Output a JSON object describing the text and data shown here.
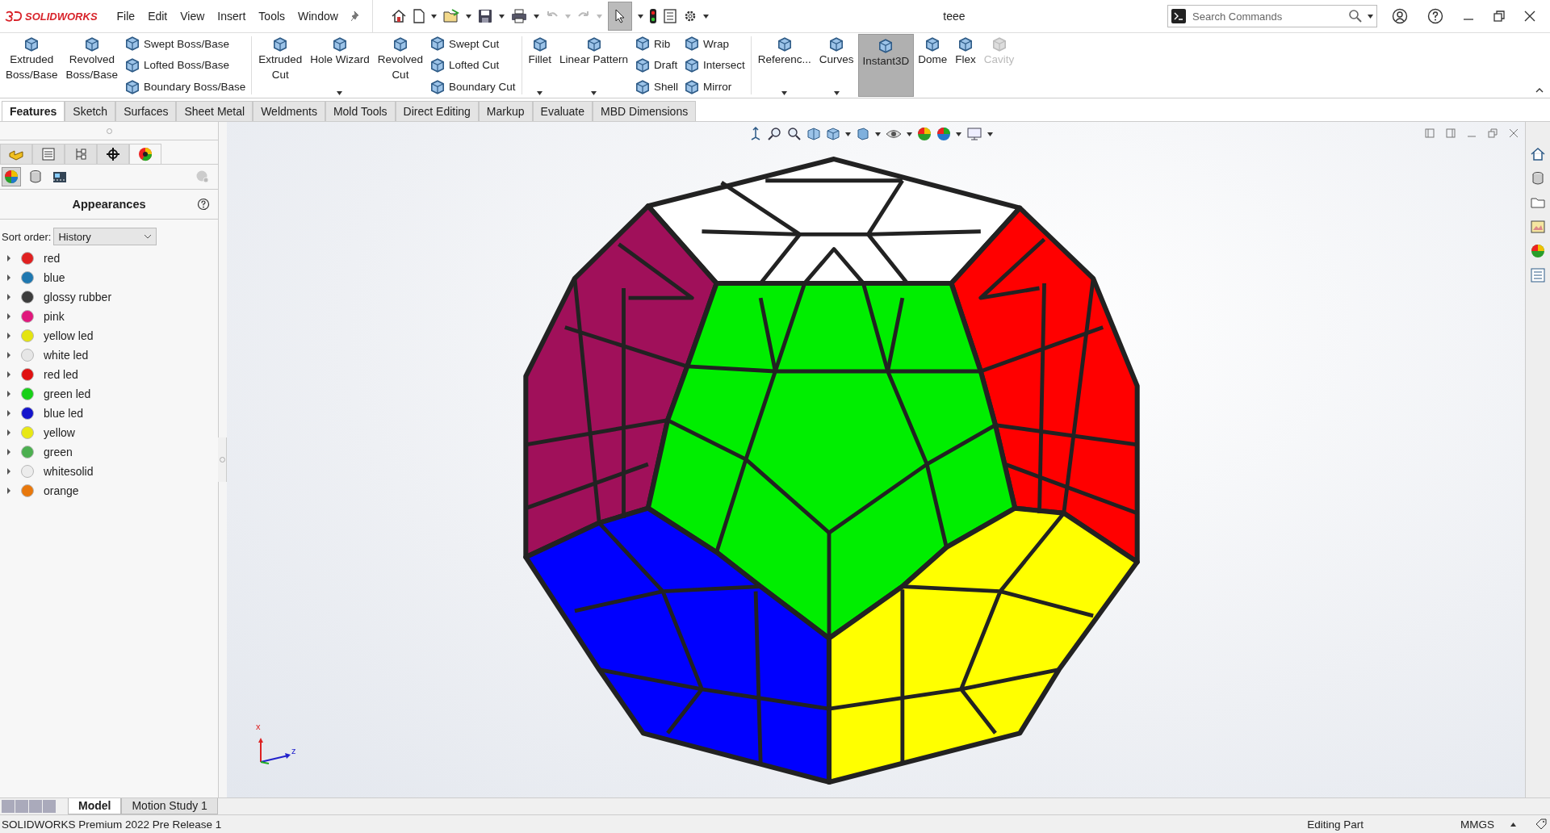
{
  "app": {
    "logo": "SOLIDWORKS"
  },
  "menu": [
    "File",
    "Edit",
    "View",
    "Insert",
    "Tools",
    "Window"
  ],
  "window": {
    "title": "teee"
  },
  "search": {
    "placeholder": "Search Commands"
  },
  "ribbon": [
    {
      "kind": "large",
      "lines": [
        "Extruded",
        "Boss/Base"
      ],
      "dropdown": false,
      "selected": false,
      "disabled": false
    },
    {
      "kind": "large",
      "lines": [
        "Revolved",
        "Boss/Base"
      ],
      "dropdown": false,
      "selected": false,
      "disabled": false
    },
    {
      "kind": "stack",
      "items": [
        "Swept Boss/Base",
        "Lofted Boss/Base",
        "Boundary Boss/Base"
      ]
    },
    {
      "kind": "separator"
    },
    {
      "kind": "large",
      "lines": [
        "Extruded",
        "Cut"
      ],
      "dropdown": false,
      "selected": false,
      "disabled": false
    },
    {
      "kind": "large",
      "lines": [
        "Hole Wizard"
      ],
      "dropdown": true,
      "selected": false,
      "disabled": false
    },
    {
      "kind": "large",
      "lines": [
        "Revolved",
        "Cut"
      ],
      "dropdown": false,
      "selected": false,
      "disabled": false
    },
    {
      "kind": "stack",
      "items": [
        "Swept Cut",
        "Lofted Cut",
        "Boundary Cut"
      ]
    },
    {
      "kind": "separator"
    },
    {
      "kind": "large",
      "lines": [
        "Fillet"
      ],
      "dropdown": true,
      "selected": false,
      "disabled": false
    },
    {
      "kind": "large",
      "lines": [
        "Linear Pattern"
      ],
      "dropdown": true,
      "selected": false,
      "disabled": false
    },
    {
      "kind": "stack",
      "items": [
        "Rib",
        "Draft",
        "Shell"
      ]
    },
    {
      "kind": "stack",
      "items": [
        "Wrap",
        "Intersect",
        "Mirror"
      ]
    },
    {
      "kind": "separator"
    },
    {
      "kind": "large",
      "lines": [
        "Referenc..."
      ],
      "dropdown": true,
      "selected": false,
      "disabled": false
    },
    {
      "kind": "large",
      "lines": [
        "Curves"
      ],
      "dropdown": true,
      "selected": false,
      "disabled": false
    },
    {
      "kind": "large",
      "lines": [
        "Instant3D"
      ],
      "dropdown": false,
      "selected": true,
      "disabled": false
    },
    {
      "kind": "large",
      "lines": [
        "Dome"
      ],
      "dropdown": false,
      "selected": false,
      "disabled": false
    },
    {
      "kind": "large",
      "lines": [
        "Flex"
      ],
      "dropdown": false,
      "selected": false,
      "disabled": false
    },
    {
      "kind": "large",
      "lines": [
        "Cavity"
      ],
      "dropdown": false,
      "selected": false,
      "disabled": true
    }
  ],
  "command_tabs": [
    {
      "label": "Features",
      "selected": true
    },
    {
      "label": "Sketch",
      "selected": false
    },
    {
      "label": "Surfaces",
      "selected": false
    },
    {
      "label": "Sheet Metal",
      "selected": false
    },
    {
      "label": "Weldments",
      "selected": false
    },
    {
      "label": "Mold Tools",
      "selected": false
    },
    {
      "label": "Direct Editing",
      "selected": false
    },
    {
      "label": "Markup",
      "selected": false
    },
    {
      "label": "Evaluate",
      "selected": false
    },
    {
      "label": "MBD Dimensions",
      "selected": false
    }
  ],
  "panel": {
    "tabs": [
      {
        "selected": false
      },
      {
        "selected": false
      },
      {
        "selected": false
      },
      {
        "selected": false
      },
      {
        "selected": true
      }
    ],
    "subtabs": [
      {
        "selected": true
      },
      {
        "selected": false
      },
      {
        "selected": false
      }
    ],
    "title": "Appearances",
    "sort_label": "Sort order:",
    "sort_value": "History",
    "appearances": [
      {
        "name": "red",
        "color": "#e02020",
        "expanded": false
      },
      {
        "name": "blue",
        "color": "#1f78b0",
        "expanded": false
      },
      {
        "name": "glossy rubber",
        "color": "#3c3c3c",
        "expanded": false
      },
      {
        "name": "pink",
        "color": "#e0187c",
        "expanded": false
      },
      {
        "name": "yellow led",
        "color": "#e4e410",
        "expanded": false
      },
      {
        "name": "white led",
        "color": "#e6e6e6",
        "expanded": false
      },
      {
        "name": "red led",
        "color": "#e01010",
        "expanded": false
      },
      {
        "name": "green led",
        "color": "#18d018",
        "expanded": false
      },
      {
        "name": "blue led",
        "color": "#1414cc",
        "expanded": false
      },
      {
        "name": "yellow",
        "color": "#e8e814",
        "expanded": false
      },
      {
        "name": "green",
        "color": "#4caf50",
        "expanded": false
      },
      {
        "name": "whitesolid",
        "color": "#ececec",
        "expanded": false
      },
      {
        "name": "orange",
        "color": "#e8780c",
        "expanded": false
      }
    ]
  },
  "viewport": {
    "triad_labels": [
      "x",
      "z"
    ]
  },
  "bottom_tabs": [
    {
      "label": "Model",
      "selected": true
    },
    {
      "label": "Motion Study 1",
      "selected": false
    }
  ],
  "status_bar": {
    "message": "SOLIDWORKS Premium 2022 Pre Release 1",
    "mode": "Editing Part",
    "units": "MMGS"
  }
}
